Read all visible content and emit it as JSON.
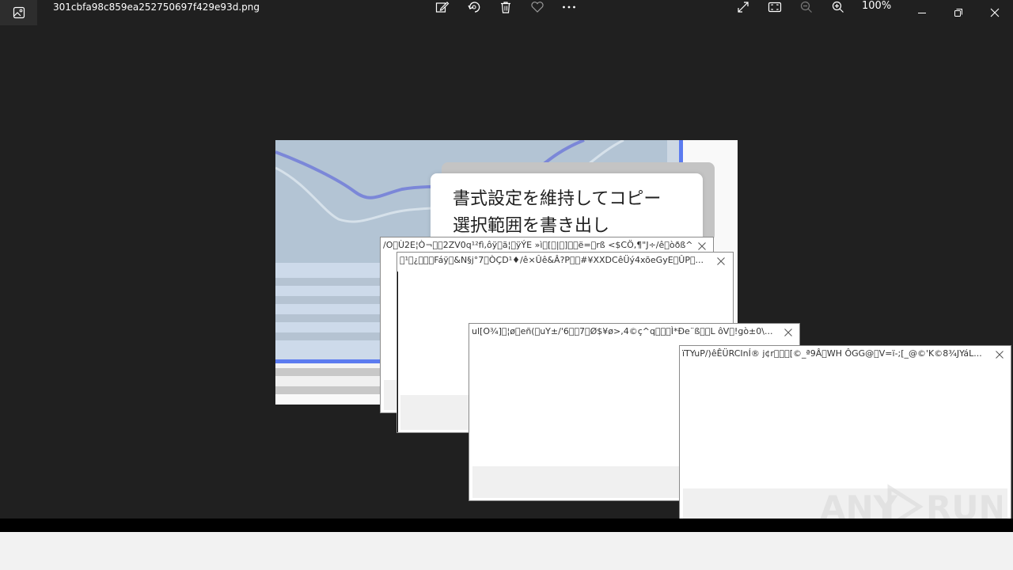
{
  "titlebar": {
    "filename": "301cbfa98c859ea252750697f429e93d.png",
    "zoom": "100%",
    "tools": [
      "edit-icon",
      "rotate-icon",
      "delete-icon",
      "favorite-icon",
      "more-icon"
    ],
    "view_tools": [
      "fullscreen-icon",
      "fit-window-icon",
      "zoom-out-icon",
      "zoom-in-icon"
    ],
    "window_controls": [
      "minimize-icon",
      "restore-icon",
      "close-icon"
    ]
  },
  "photo": {
    "card_lines": [
      "書式設定を維持してコピー",
      "選択範囲を書き出し"
    ],
    "accent_color": "#5c7cf0",
    "curve_color": "#7b87d8"
  },
  "popups": [
    {
      "title": "/O\u0000Ù2E¦Ò¬\u0000\u00002ZV0q¹²fì,ôÿ\u0000ã¦\u0000ÿÝE »ì\u0000[\u0000|\u0000]\u0000\u0000ë=\u0000rß <$CÖ,¶\"J÷/ê\u0000òðß^..."
    },
    {
      "title": "\u0000¹\u0000¿\u0000\u0000\u0000Fáÿ\u0000&N§j°7\u0000ÒÇD¹♦/ê×Ûê&Â?P\u0000\u0000#¥XXDCêÜý4xõeGyE\u0000ÛP\u0000..."
    },
    {
      "title": "ul[O¾]\u0000¦ø\u0000eñ(\u0000uY±/'6\u0000\u00007\u0000Ø$¥ø>,4©ç^q\u0000\u0000\u0000Ì*Ðe¨ß\u0000\u0000L ôV\u0000!gò±0\\..."
    },
    {
      "title": "ïTYuP/)êÊÜRCInÍ® j¢r\u0000\u0000\u0000[©_ª9Â\u0000WH  ÔGG@\u0000V=ï-;[_@©'K©8¾JYáL..."
    }
  ],
  "watermark": {
    "text": "ANY RUN"
  }
}
